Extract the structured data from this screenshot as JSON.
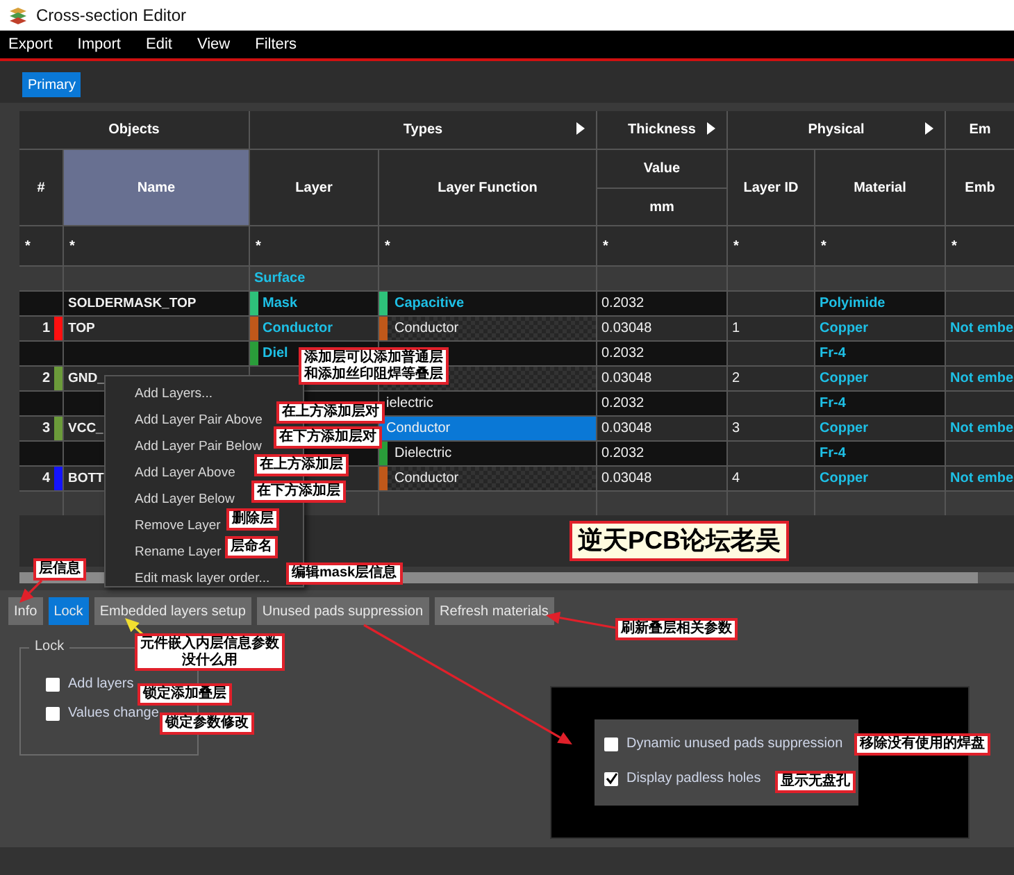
{
  "window": {
    "title": "Cross-section Editor"
  },
  "menu": [
    "Export",
    "Import",
    "Edit",
    "View",
    "Filters"
  ],
  "sheet_tabs": [
    {
      "label": "Primary",
      "selected": true
    }
  ],
  "table": {
    "groups": [
      {
        "label": "Objects",
        "expandable": false
      },
      {
        "label": "Types",
        "expandable": true
      },
      {
        "label": "Thickness",
        "expandable": true
      },
      {
        "label": "Physical",
        "expandable": true
      },
      {
        "label": "Em",
        "expandable": false
      }
    ],
    "columns": [
      {
        "label": "#",
        "selected": false
      },
      {
        "label": "Name",
        "selected": true
      },
      {
        "label": "Layer",
        "selected": false
      },
      {
        "label": "Layer Function",
        "selected": false
      },
      {
        "label": "Value",
        "selected": false
      },
      {
        "label": "Layer ID",
        "selected": false
      },
      {
        "label": "Material",
        "selected": false
      },
      {
        "label": "Emb",
        "selected": false
      }
    ],
    "unit": "mm",
    "filters": [
      "*",
      "*",
      "*",
      "*",
      "*",
      "*",
      "*",
      "*"
    ],
    "rows": [
      {
        "kind": "surface",
        "layer": {
          "label": "Surface"
        }
      },
      {
        "kind": "mask",
        "name": "SOLDERMASK_TOP",
        "layer": {
          "label": "Mask",
          "color": "#2ec27a"
        },
        "function": {
          "label": "Capacitive",
          "color": "#2ec27a"
        },
        "value": "0.2032",
        "material": "Polyimide",
        "selected": false
      },
      {
        "kind": "conductor",
        "num": "1",
        "color": "#ff1010",
        "name": "TOP",
        "layer": {
          "label": "Conductor",
          "color": "#c0581a"
        },
        "function": {
          "label": "Conductor",
          "color": "#c0581a"
        },
        "value": "0.03048",
        "layer_id": "1",
        "material": "Copper",
        "embedded": "Not embe",
        "selected": false
      },
      {
        "kind": "dielectric",
        "layer": {
          "label": "Diel",
          "color": "#2a9d3a"
        },
        "value": "0.2032",
        "material": "Fr-4",
        "selected": false
      },
      {
        "kind": "conductor",
        "num": "2",
        "color": "#6b9b3a",
        "name": "GND_",
        "value": "0.03048",
        "layer_id": "2",
        "material": "Copper",
        "embedded": "Not embe",
        "selected": false
      },
      {
        "kind": "dielectric",
        "function": {
          "label": "ielectric"
        },
        "value": "0.2032",
        "material": "Fr-4",
        "selected": false
      },
      {
        "kind": "conductor",
        "num": "3",
        "color": "#6b9b3a",
        "name": "VCC_",
        "function": {
          "label": "Conductor"
        },
        "value": "0.03048",
        "layer_id": "3",
        "material": "Copper",
        "embedded": "Not embe",
        "selected": true
      },
      {
        "kind": "dielectric",
        "function": {
          "label": "Dielectric",
          "color": "#2a9d3a"
        },
        "value": "0.2032",
        "material": "Fr-4",
        "selected": false
      },
      {
        "kind": "conductor",
        "num": "4",
        "color": "#1414ff",
        "name": "BOTT",
        "function": {
          "label": "Conductor",
          "color": "#c0581a"
        },
        "value": "0.03048",
        "layer_id": "4",
        "material": "Copper",
        "embedded": "Not embe",
        "selected": false
      },
      {
        "kind": "empty"
      }
    ]
  },
  "context_menu": [
    "Add Layers...",
    "Add Layer Pair Above",
    "Add Layer Pair Below",
    "Add Layer Above",
    "Add Layer Below",
    "Remove Layer",
    "Rename Layer",
    "Edit mask layer order..."
  ],
  "bottom_tabs": [
    {
      "label": "Info",
      "selected": false
    },
    {
      "label": "Lock",
      "selected": true
    },
    {
      "label": "Embedded layers setup",
      "selected": false
    },
    {
      "label": "Unused pads suppression",
      "selected": false
    },
    {
      "label": "Refresh materials",
      "selected": false
    }
  ],
  "lock_group": {
    "title": "Lock",
    "options": [
      {
        "label": "Add layers",
        "checked": false
      },
      {
        "label": "Values change",
        "checked": false
      }
    ]
  },
  "pads_panel": {
    "options": [
      {
        "label": "Dynamic unused pads suppression",
        "checked": false
      },
      {
        "label": "Display padless holes",
        "checked": true
      }
    ]
  },
  "annotations": [
    {
      "kind": "note",
      "lines": [
        "添加层可以添加普通层",
        "和添加丝印阻焊等叠层"
      ]
    },
    {
      "kind": "note",
      "lines": [
        "在上方添加层对"
      ]
    },
    {
      "kind": "note",
      "lines": [
        "在下方添加层对"
      ]
    },
    {
      "kind": "note",
      "lines": [
        "在上方添加层"
      ]
    },
    {
      "kind": "note",
      "lines": [
        "在下方添加层"
      ]
    },
    {
      "kind": "note",
      "lines": [
        "删除层"
      ]
    },
    {
      "kind": "note",
      "lines": [
        "层命名"
      ]
    },
    {
      "kind": "note",
      "lines": [
        "编辑mask层信息"
      ]
    },
    {
      "kind": "banner",
      "lines": [
        "逆天PCB论坛老吴"
      ]
    },
    {
      "kind": "note",
      "lines": [
        "层信息"
      ]
    },
    {
      "kind": "note",
      "lines": [
        "元件嵌入内层信息参数",
        "没什么用"
      ]
    },
    {
      "kind": "note",
      "lines": [
        "刷新叠层相关参数"
      ]
    },
    {
      "kind": "note",
      "lines": [
        "锁定添加叠层"
      ]
    },
    {
      "kind": "note",
      "lines": [
        "锁定参数修改"
      ]
    },
    {
      "kind": "note",
      "lines": [
        "移除没有使用的焊盘"
      ]
    },
    {
      "kind": "note",
      "lines": [
        "显示无盘孔"
      ]
    }
  ]
}
